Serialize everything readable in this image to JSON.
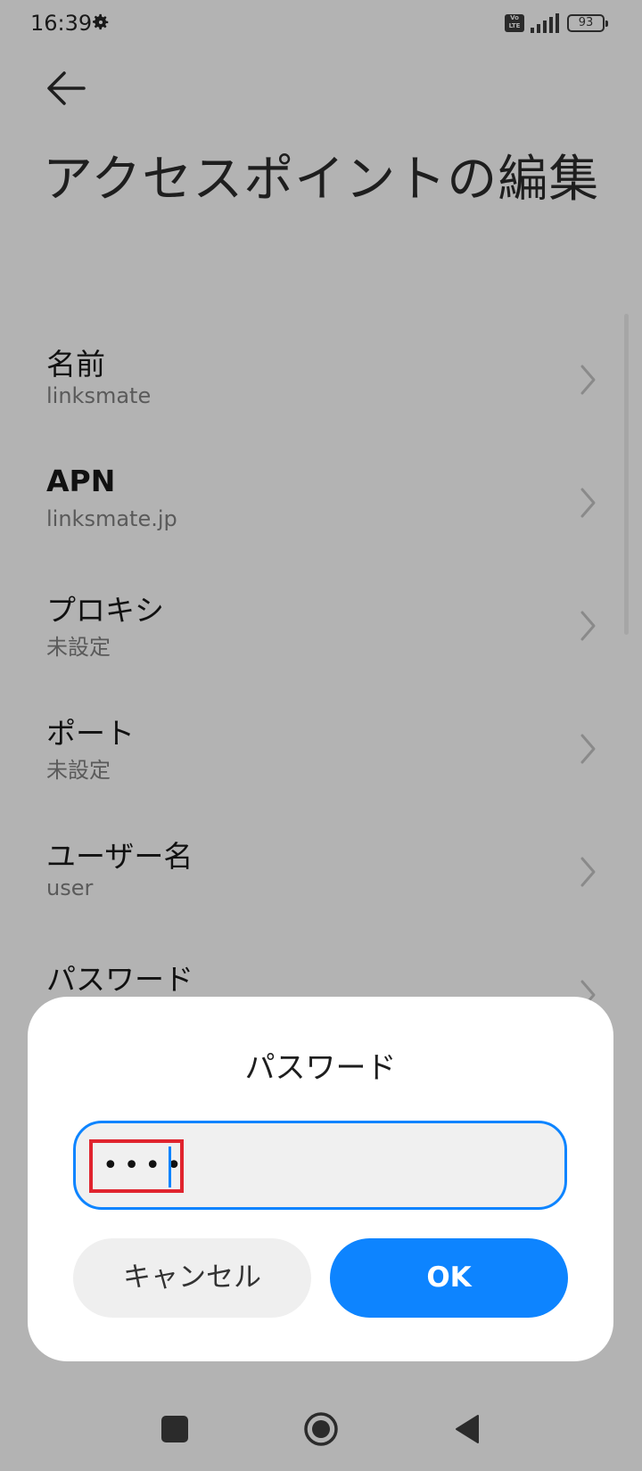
{
  "status_bar": {
    "time": "16:39",
    "battery": "93",
    "volte": "Vo LTE",
    "icons": [
      "gear-icon",
      "volte-icon",
      "signal-icon",
      "battery-icon"
    ]
  },
  "header": {
    "back_icon": "back-arrow-icon",
    "title": "アクセスポイントの編集"
  },
  "settings": [
    {
      "title": "名前",
      "value": "linksmate"
    },
    {
      "title": "APN",
      "value": "linksmate.jp"
    },
    {
      "title": "プロキシ",
      "value": "未設定"
    },
    {
      "title": "ポート",
      "value": "未設定"
    },
    {
      "title": "ユーザー名",
      "value": "user"
    },
    {
      "title": "パスワード",
      "value": ""
    }
  ],
  "dialog": {
    "title": "パスワード",
    "password_display": "••••",
    "cancel_label": "キャンセル",
    "ok_label": "OK"
  },
  "colors": {
    "accent": "#0d84ff",
    "highlight": "#e0242e",
    "scrim": "#b3b3b3"
  },
  "nav_bar": {
    "icons": [
      "recents-square-icon",
      "home-circle-icon",
      "back-triangle-icon"
    ]
  }
}
